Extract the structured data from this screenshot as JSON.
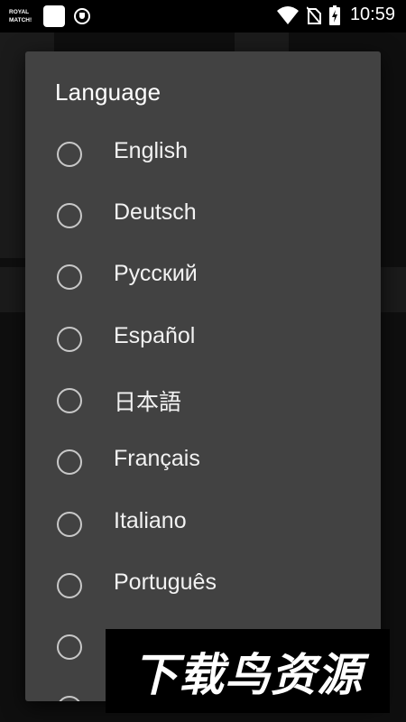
{
  "status_bar": {
    "app_logo_text": "ROYAL MATCH!",
    "time": "10:59",
    "icons": [
      "royal-match-icon",
      "notification-square-icon",
      "shield-icon",
      "wifi-icon",
      "no-sim-icon",
      "battery-charging-icon"
    ]
  },
  "dialog": {
    "title": "Language",
    "options": [
      {
        "label": "English",
        "selected": false
      },
      {
        "label": "Deutsch",
        "selected": false
      },
      {
        "label": "Русский",
        "selected": false
      },
      {
        "label": "Español",
        "selected": false
      },
      {
        "label": "日本語",
        "selected": false
      },
      {
        "label": "Français",
        "selected": false
      },
      {
        "label": "Italiano",
        "selected": false
      },
      {
        "label": "Português",
        "selected": false
      },
      {
        "label": "",
        "selected": false
      }
    ]
  },
  "watermark": {
    "text": "下载鸟资源"
  },
  "colors": {
    "dialog_bg": "#424242",
    "radio": "#c8c8c8",
    "text": "#f2f2f2"
  }
}
